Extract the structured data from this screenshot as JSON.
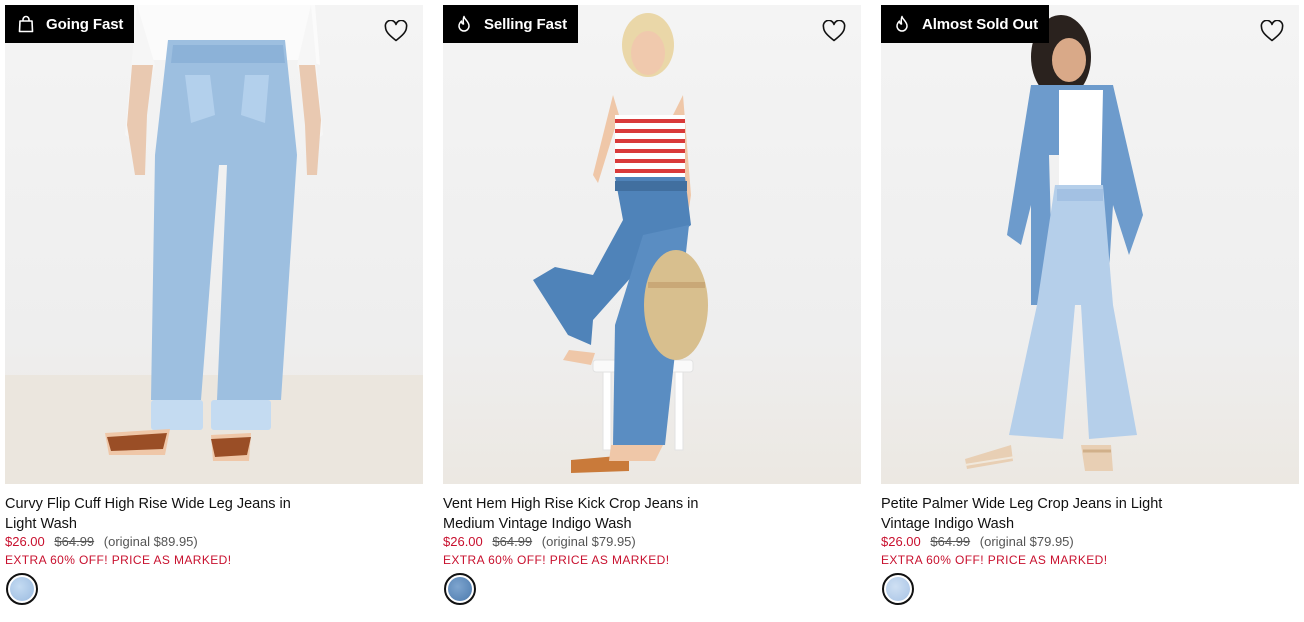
{
  "colors": {
    "badge_bg": "#000000",
    "badge_text": "#ffffff",
    "sale_price": "#c8102e",
    "promo_text": "#c8102e",
    "muted_text": "#555555"
  },
  "products": [
    {
      "badge": {
        "label": "Going Fast",
        "icon": "shopping-bag-icon"
      },
      "wishlist_icon": "heart-outline-icon",
      "name_line1": "Curvy Flip Cuff High Rise Wide Leg Jeans in",
      "name_line2": "Light Wash",
      "price": "$26.00",
      "was_price": "$64.99",
      "original": "(original $89.95)",
      "promo": "EXTRA 60% OFF! PRICE AS MARKED!",
      "swatch_color": "#a9c6e6"
    },
    {
      "badge": {
        "label": "Selling Fast",
        "icon": "flame-icon"
      },
      "wishlist_icon": "heart-outline-icon",
      "name_line1": "Vent Hem High Rise Kick Crop Jeans in",
      "name_line2": "Medium Vintage Indigo Wash",
      "price": "$26.00",
      "was_price": "$64.99",
      "original": "(original $79.95)",
      "promo": "EXTRA 60% OFF! PRICE AS MARKED!",
      "swatch_color": "#5b86b8"
    },
    {
      "badge": {
        "label": "Almost Sold Out",
        "icon": "flame-icon"
      },
      "wishlist_icon": "heart-outline-icon",
      "name_line1": "Petite Palmer Wide Leg Crop Jeans in Light",
      "name_line2": "Vintage Indigo Wash",
      "price": "$26.00",
      "was_price": "$64.99",
      "original": "(original $79.95)",
      "promo": "EXTRA 60% OFF! PRICE AS MARKED!",
      "swatch_color": "#b4cdea"
    }
  ]
}
